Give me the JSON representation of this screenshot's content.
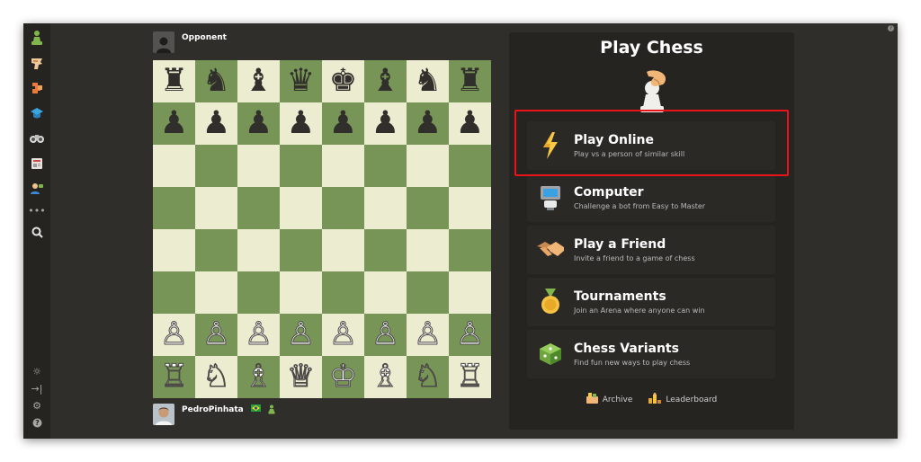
{
  "top_player": {
    "name": "Opponent"
  },
  "bottom_player": {
    "name": "PedroPinhata",
    "flag_icon": "flag-icon",
    "badge_icon": "pawn-badge-icon"
  },
  "board": {
    "rows": [
      [
        "♜",
        "♞",
        "♝",
        "♛",
        "♚",
        "♝",
        "♞",
        "♜"
      ],
      [
        "♟",
        "♟",
        "♟",
        "♟",
        "♟",
        "♟",
        "♟",
        "♟"
      ],
      [
        "",
        "",
        "",
        "",
        "",
        "",
        "",
        ""
      ],
      [
        "",
        "",
        "",
        "",
        "",
        "",
        "",
        ""
      ],
      [
        "",
        "",
        "",
        "",
        "",
        "",
        "",
        ""
      ],
      [
        "",
        "",
        "",
        "",
        "",
        "",
        "",
        ""
      ],
      [
        "♙",
        "♙",
        "♙",
        "♙",
        "♙",
        "♙",
        "♙",
        "♙"
      ],
      [
        "♖",
        "♘",
        "♗",
        "♕",
        "♔",
        "♗",
        "♘",
        "♖"
      ]
    ],
    "light_color": "#ebecd0",
    "dark_color": "#779556"
  },
  "panel": {
    "title": "Play Chess",
    "menu": [
      {
        "title": "Play Online",
        "subtitle": "Play vs a person of similar skill",
        "icon": "lightning-icon"
      },
      {
        "title": "Computer",
        "subtitle": "Challenge a bot from Easy to Master",
        "icon": "computer-icon"
      },
      {
        "title": "Play a Friend",
        "subtitle": "Invite a friend to a game of chess",
        "icon": "handshake-icon"
      },
      {
        "title": "Tournaments",
        "subtitle": "Join an Arena where anyone can win",
        "icon": "medal-icon"
      },
      {
        "title": "Chess Variants",
        "subtitle": "Find fun new ways to play chess",
        "icon": "dice-icon"
      }
    ],
    "footer": [
      {
        "label": "Archive",
        "icon": "archive-icon"
      },
      {
        "label": "Leaderboard",
        "icon": "leaderboard-icon"
      }
    ]
  },
  "sidebar": {
    "top_icons": [
      "pawn-logo-icon",
      "puzzle-icon",
      "learn-icon",
      "lessons-icon",
      "watch-icon",
      "news-icon",
      "social-icon",
      "more-icon",
      "search-icon"
    ],
    "bottom_icons": [
      "theme-icon",
      "collapse-icon",
      "settings-icon",
      "help-icon"
    ]
  },
  "colors": {
    "brand": "#81b64c",
    "background": "#302e2b",
    "panel": "#262421",
    "highlight": "#e8141a"
  }
}
